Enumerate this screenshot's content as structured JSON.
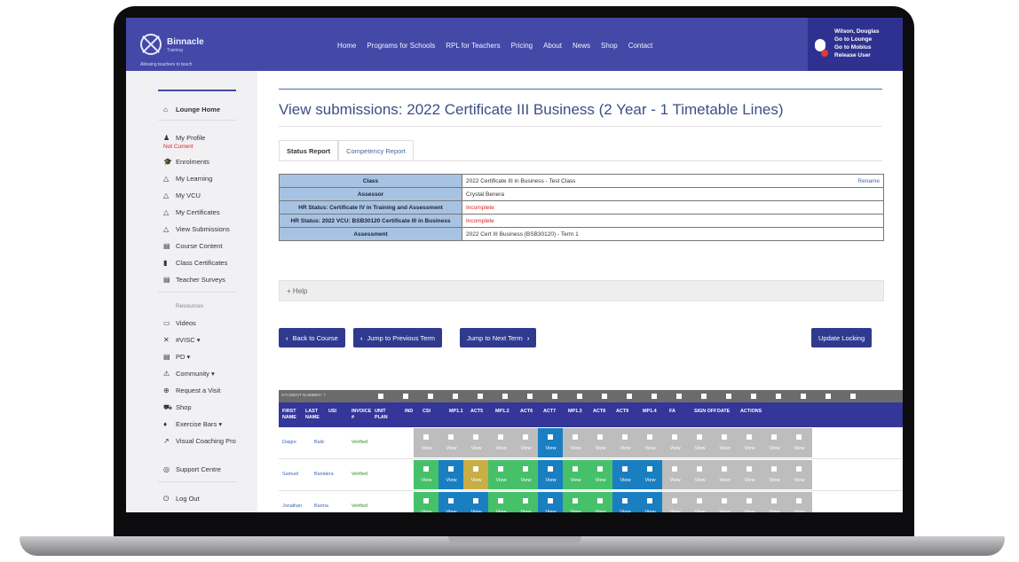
{
  "header": {
    "brand": "Binnacle",
    "brand_sub": "Training",
    "tagline": "Allowing teachers to teach",
    "nav": [
      "Home",
      "Programs for Schools",
      "RPL for Teachers",
      "Pricing",
      "About",
      "News",
      "Shop",
      "Contact"
    ],
    "user": {
      "name": "Wilson, Douglas",
      "links": [
        "Go to Lounge",
        "Go to Mobius",
        "Release User"
      ]
    }
  },
  "sidebar": {
    "items": [
      {
        "icon": "⌂",
        "label": "Lounge Home",
        "bold": true
      },
      {
        "icon": "♟",
        "label": "My Profile",
        "sub": "Not Current"
      },
      {
        "icon": "🎓",
        "label": "Enrolments"
      },
      {
        "icon": "△",
        "label": "My Learning"
      },
      {
        "icon": "△",
        "label": "My VCU"
      },
      {
        "icon": "△",
        "label": "My Certificates"
      },
      {
        "icon": "△",
        "label": "View Submissions"
      },
      {
        "icon": "▤",
        "label": "Course Content"
      },
      {
        "icon": "▮",
        "label": "Class Certificates"
      },
      {
        "icon": "▤",
        "label": "Teacher Surveys"
      }
    ],
    "resources_heading": "Resources",
    "resources": [
      {
        "icon": "▭",
        "label": "Videos"
      },
      {
        "icon": "✕",
        "label": "#VISC ▾"
      },
      {
        "icon": "▤",
        "label": "PD ▾"
      },
      {
        "icon": "⚠",
        "label": "Community ▾"
      },
      {
        "icon": "⊕",
        "label": "Request a Visit"
      },
      {
        "icon": "⛟",
        "label": "Shop"
      },
      {
        "icon": "♦",
        "label": "Exercise Bars ▾"
      },
      {
        "icon": "↗",
        "label": "Visual Coaching Pro"
      },
      {
        "icon": "◎",
        "label": "Support Centre"
      }
    ],
    "logout": "Log Out"
  },
  "main": {
    "title": "View submissions: 2022 Certificate III Business (2 Year - 1 Timetable Lines)",
    "tabs": [
      "Status Report",
      "Competency Report"
    ],
    "info_rows": [
      {
        "key": "Class",
        "value": "2022 Certificate III in Business - Test Class",
        "extra": "Rename"
      },
      {
        "key": "Assessor",
        "value": "Crystal Benera"
      },
      {
        "key": "HR Status: Certificate IV in Training and Assessment",
        "value": "Incomplete",
        "red": true
      },
      {
        "key": "HR Status: 2022 VCU: BSB30120 Certificate III in Business",
        "value": "Incomplete",
        "red": true
      },
      {
        "key": "Assessment",
        "value": "2022 Cert III Business (BSB30120) - Term 1"
      }
    ],
    "help_label": "+ Help",
    "buttons": {
      "back": "Back to Course",
      "prev": "Jump to Previous Term",
      "next": "Jump to Next Term",
      "update": "Update Locking"
    },
    "grid": {
      "student_label": "STUDENT NUMBER: 7",
      "columns": [
        "FIRST NAME",
        "LAST NAME",
        "USI",
        "INVOICE #",
        "UNIT PLAN",
        "IND",
        "CSI",
        "MP1.1",
        "ACT5",
        "MP1.2",
        "ACT6",
        "ACT7",
        "MP1.3",
        "ACT8",
        "ACT9",
        "MP1.4",
        "FA",
        "SIGN OFF",
        "DATE",
        "ACTIONS"
      ],
      "view_label": "View",
      "rows": [
        {
          "first": "Daigre",
          "last": "Balic",
          "usi": "Verified",
          "cells": [
            "gray",
            "gray",
            "gray",
            "gray",
            "gray",
            "blue",
            "gray",
            "gray",
            "gray",
            "gray",
            "gray",
            "gray",
            "gray",
            "gray",
            "gray",
            "gray"
          ]
        },
        {
          "first": "Samuel",
          "last": "Bandiera",
          "usi": "Verified",
          "cells": [
            "green",
            "blue",
            "gold",
            "green",
            "green",
            "blue",
            "green",
            "green",
            "blue",
            "blue",
            "gray",
            "gray",
            "gray",
            "gray",
            "gray",
            "gray"
          ]
        },
        {
          "first": "Jonathan",
          "last": "Barma",
          "usi": "Verified",
          "cells": [
            "green",
            "blue",
            "blue",
            "green",
            "green",
            "blue",
            "green",
            "green",
            "blue",
            "blue",
            "gray",
            "gray",
            "gray",
            "gray",
            "gray",
            "gray"
          ]
        }
      ]
    }
  },
  "colors": {
    "header": "#4448a6",
    "table_key": "#a7c3e3",
    "button": "#2f3a8f",
    "green": "#47c06a",
    "blue": "#1a7fc1",
    "gold": "#c9ad45",
    "gray": "#bdbdbd"
  }
}
